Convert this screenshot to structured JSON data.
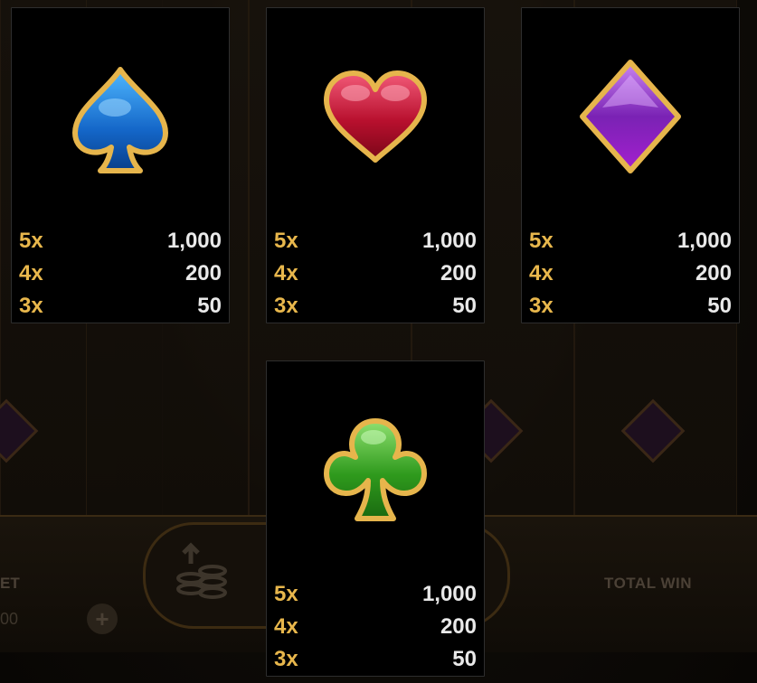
{
  "background": {
    "bet_label": "ET",
    "bet_value": "00",
    "plus_label": "+",
    "total_win_label": "TOTAL WIN"
  },
  "paytable": [
    {
      "symbol": "spade-icon",
      "color": "#1a7ed6",
      "rows": [
        {
          "multiplier": "5x",
          "payout": "1,000"
        },
        {
          "multiplier": "4x",
          "payout": "200"
        },
        {
          "multiplier": "3x",
          "payout": "50"
        }
      ]
    },
    {
      "symbol": "heart-icon",
      "color": "#c01533",
      "rows": [
        {
          "multiplier": "5x",
          "payout": "1,000"
        },
        {
          "multiplier": "4x",
          "payout": "200"
        },
        {
          "multiplier": "3x",
          "payout": "50"
        }
      ]
    },
    {
      "symbol": "diamond-icon",
      "color": "#8b2fc4",
      "rows": [
        {
          "multiplier": "5x",
          "payout": "1,000"
        },
        {
          "multiplier": "4x",
          "payout": "200"
        },
        {
          "multiplier": "3x",
          "payout": "50"
        }
      ]
    },
    {
      "symbol": "club-icon",
      "color": "#2e9a1c",
      "rows": [
        {
          "multiplier": "5x",
          "payout": "1,000"
        },
        {
          "multiplier": "4x",
          "payout": "200"
        },
        {
          "multiplier": "3x",
          "payout": "50"
        }
      ]
    }
  ],
  "colors": {
    "multiplier": "#e8b74c",
    "payout": "#e9e9e9",
    "gold_frame": "#e2b34a"
  }
}
